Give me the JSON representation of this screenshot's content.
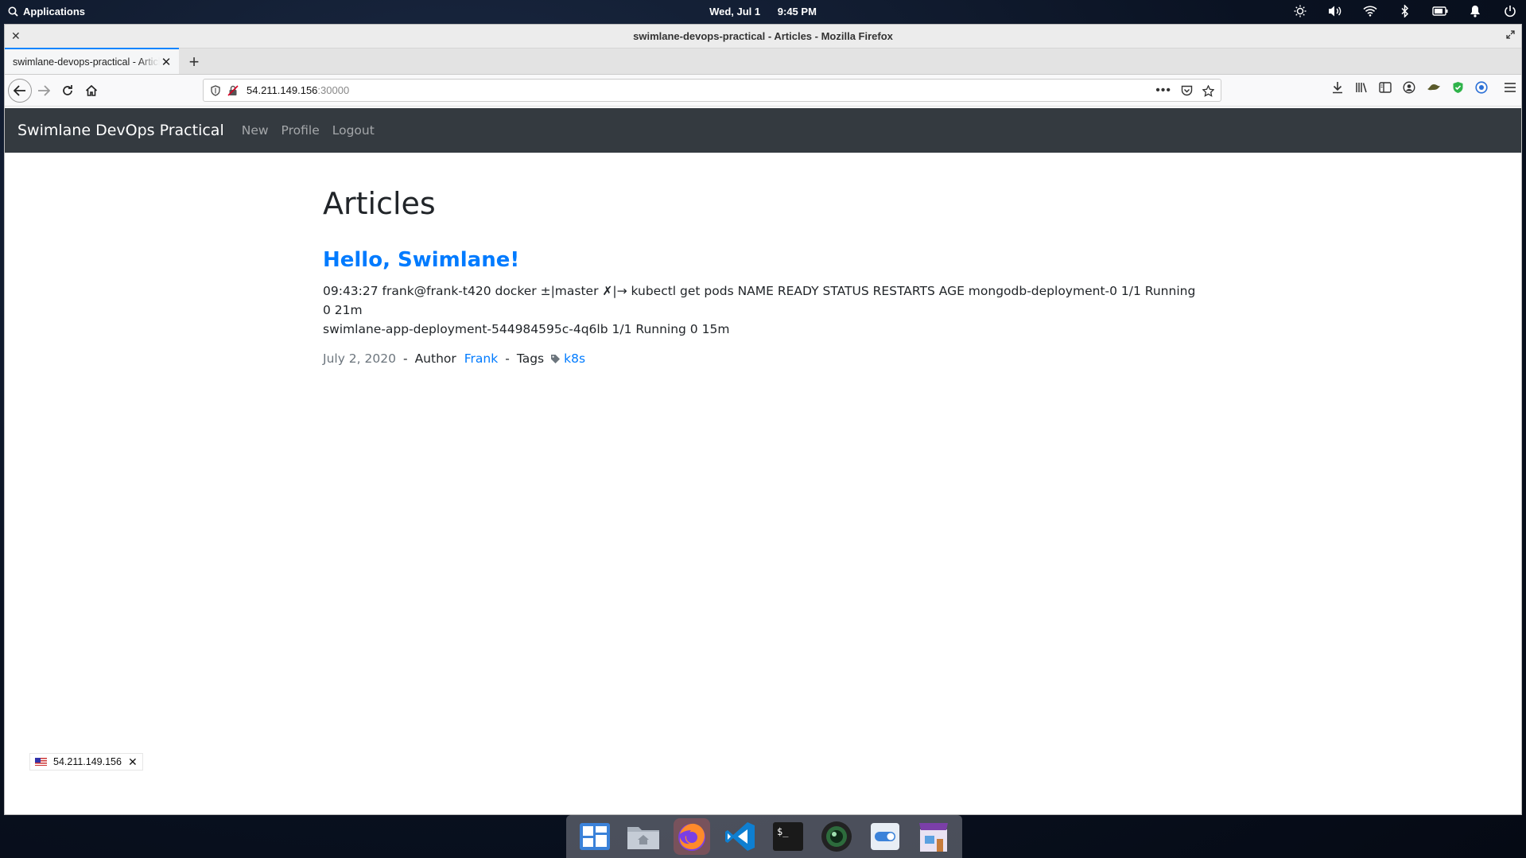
{
  "system_panel": {
    "apps_label": "Applications",
    "date": "Wed, Jul 1",
    "time": "9:45 PM"
  },
  "window": {
    "title": "swimlane-devops-practical - Articles - Mozilla Firefox"
  },
  "browser": {
    "tab_title": "swimlane-devops-practical - Articles",
    "url_host": "54.211.149.156",
    "url_port": ":30000"
  },
  "app": {
    "brand": "Swimlane DevOps Practical",
    "nav": [
      "New",
      "Profile",
      "Logout"
    ]
  },
  "page": {
    "heading": "Articles",
    "articles": [
      {
        "title": "Hello, Swimlane!",
        "body_line1": "09:43:27 frank@frank-t420 docker ±|master ✗|→ kubectl get pods NAME READY STATUS RESTARTS AGE mongodb-deployment-0 1/1 Running 0 21m",
        "body_line2": "swimlane-app-deployment-544984595c-4q6lb 1/1 Running 0 15m",
        "date": "July 2, 2020",
        "author_label": "Author",
        "author": "Frank",
        "tags_label": "Tags",
        "tag": "k8s",
        "separator": "-"
      }
    ]
  },
  "status_badge": {
    "ip": "54.211.149.156"
  },
  "colors": {
    "link": "#007bff",
    "navbar": "#343a40",
    "accent_tab": "#0a84ff"
  },
  "dock": {
    "items": [
      "workspaces-icon",
      "files-icon",
      "firefox-icon",
      "vscode-icon",
      "terminal-icon",
      "camera-icon",
      "settings-icon",
      "store-icon"
    ]
  }
}
